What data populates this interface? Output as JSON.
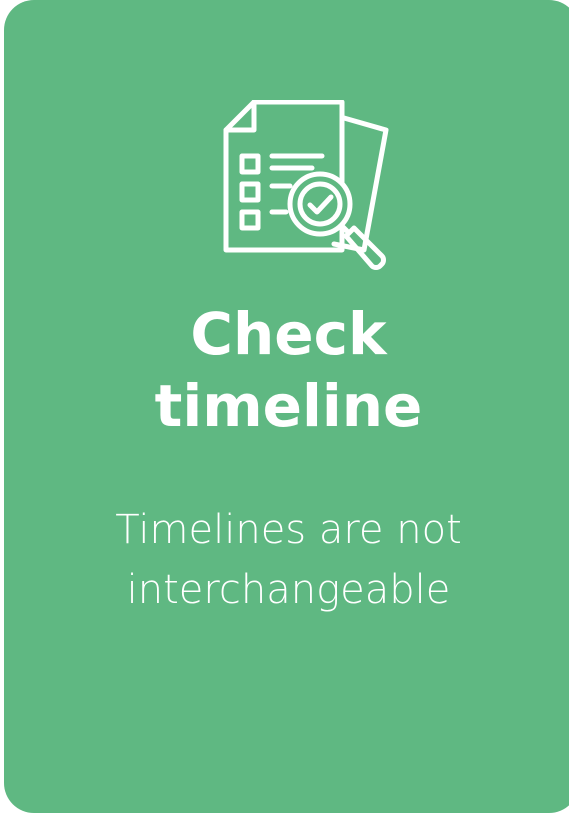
{
  "card": {
    "background": "#5fb882",
    "text_color": "#ffffff",
    "icon": "document-checklist-magnifier-icon",
    "title_line1": "Check",
    "title_line2": "timeline",
    "subtitle_line1": "Timelines are not",
    "subtitle_line2": "interchangeable"
  }
}
